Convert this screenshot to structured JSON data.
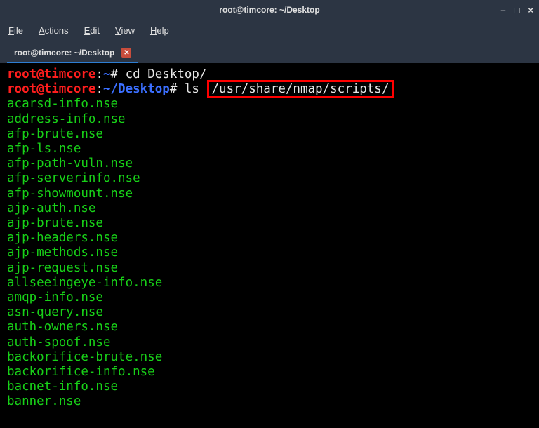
{
  "titlebar": {
    "title": "root@timcore: ~/Desktop"
  },
  "window_controls": {
    "minimize": "–",
    "maximize": "□",
    "close": "×"
  },
  "menubar": {
    "file": "File",
    "actions": "Actions",
    "edit": "Edit",
    "view": "View",
    "help": "Help"
  },
  "tab": {
    "label": "root@timcore: ~/Desktop",
    "close": "✕"
  },
  "prompt1": {
    "user_host": "root@timcore",
    "colon": ":",
    "path": "~",
    "hash": "#",
    "cmd": " cd Desktop/"
  },
  "prompt2": {
    "user_host": "root@timcore",
    "colon": ":",
    "path": "~/Desktop",
    "hash": "#",
    "cmd_ls": " ls ",
    "cmd_path": "/usr/share/nmap/scripts/"
  },
  "files": [
    "acarsd-info.nse",
    "address-info.nse",
    "afp-brute.nse",
    "afp-ls.nse",
    "afp-path-vuln.nse",
    "afp-serverinfo.nse",
    "afp-showmount.nse",
    "ajp-auth.nse",
    "ajp-brute.nse",
    "ajp-headers.nse",
    "ajp-methods.nse",
    "ajp-request.nse",
    "allseeingeye-info.nse",
    "amqp-info.nse",
    "asn-query.nse",
    "auth-owners.nse",
    "auth-spoof.nse",
    "backorifice-brute.nse",
    "backorifice-info.nse",
    "bacnet-info.nse",
    "banner.nse"
  ]
}
